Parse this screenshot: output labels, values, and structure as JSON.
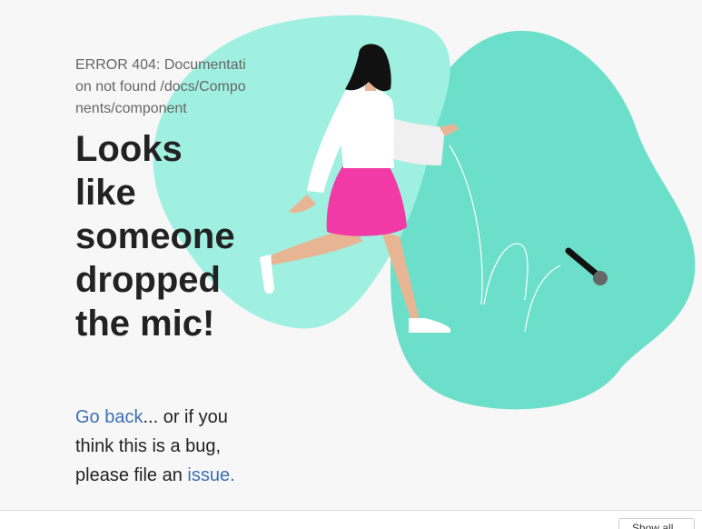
{
  "error": {
    "code_text": "ERROR 404: Documentation not found /docs/Components/component"
  },
  "headline": "Looks like someone dropped the mic!",
  "body": {
    "link_back": "Go back",
    "text_middle": "... or if you think this is a bug, please file an ",
    "link_issue": "issue."
  },
  "bottom_bar": {
    "button_label": "Show all"
  },
  "colors": {
    "blob_left": "#a0f0e1",
    "blob_right": "#6cdfca",
    "skirt": "#f23aa7",
    "link": "#3b6fb6"
  }
}
